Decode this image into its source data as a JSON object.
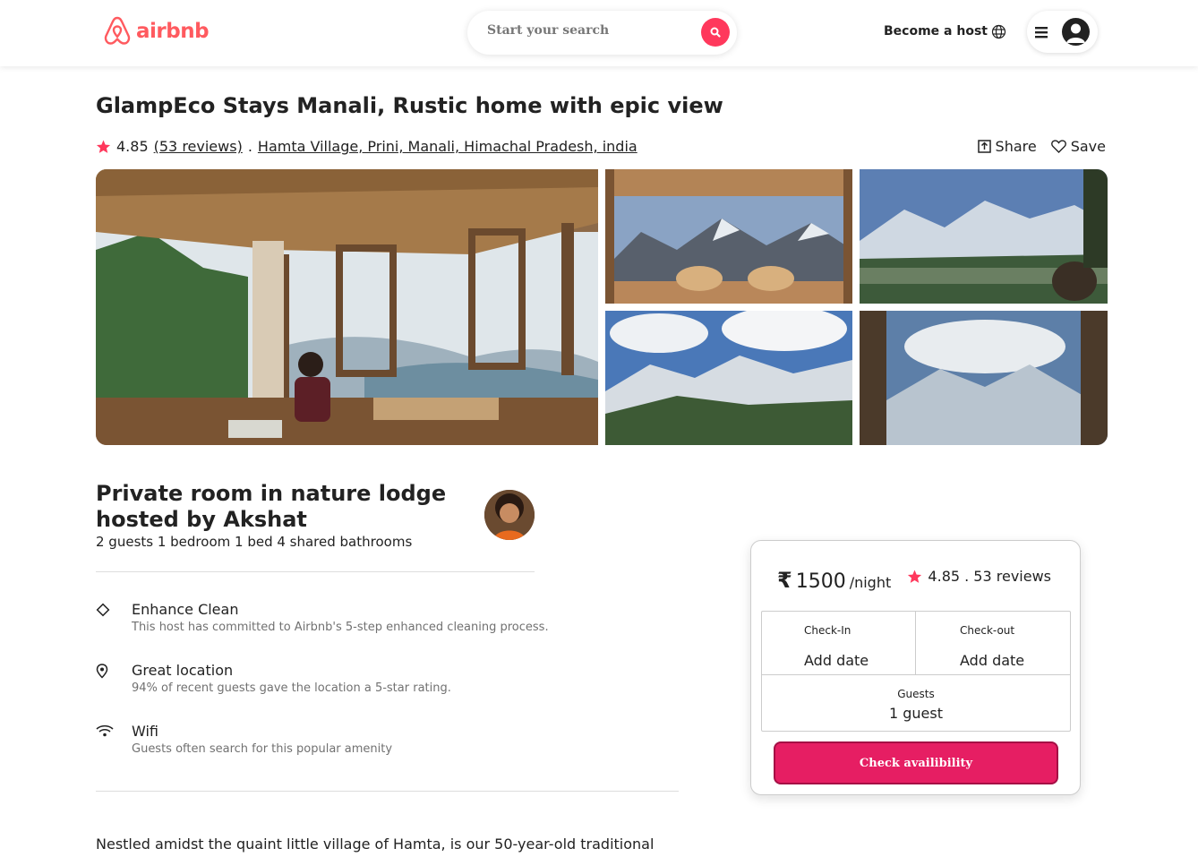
{
  "header": {
    "logo_text": "airbnb",
    "search_placeholder": "Start your search",
    "become_host": "Become a host",
    "brand_color": "#ff5a5f"
  },
  "listing": {
    "title": "GlampEco Stays Manali, Rustic home with epic view",
    "rating": "4.85",
    "reviews_link": "(53 reviews)",
    "separator": ".",
    "location": "Hamta Village, Prini, Manali, Himachal Pradesh, india",
    "share_label": "Share",
    "save_label": "Save"
  },
  "room": {
    "title": "Private room in nature lodge hosted by Akshat",
    "subtitle": "2 guests 1 bedroom 1 bed 4 shared bathrooms"
  },
  "features": [
    {
      "icon": "diamond-icon",
      "name": "Enhance Clean",
      "desc": "This host has committed to Airbnb's 5-step enhanced cleaning process."
    },
    {
      "icon": "location-pin-icon",
      "name": "Great location",
      "desc": "94% of recent guests gave the location a 5-star rating."
    },
    {
      "icon": "wifi-icon",
      "name": "Wifi",
      "desc": "Guests often search for this popular amenity"
    }
  ],
  "description": "Nestled amidst the quaint little village of Hamta, is our 50-year-old traditional",
  "booking": {
    "currency": "₹",
    "price": "1500",
    "per": "/night",
    "rating_summary": "4.85 . 53 reviews",
    "checkin_label": "Check-In",
    "checkin_value": "Add date",
    "checkout_label": "Check-out",
    "checkout_value": "Add date",
    "guests_label": "Guests",
    "guests_value": "1 guest",
    "cta": "Check availibility",
    "cta_color": "#e61e63"
  }
}
